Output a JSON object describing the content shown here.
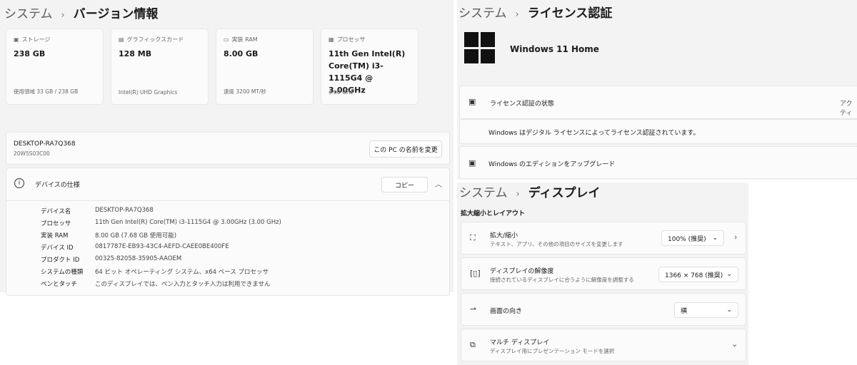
{
  "about": {
    "crumb_parent": "システム",
    "crumb_current": "バージョン情報",
    "cards": [
      {
        "icon": "storage-icon",
        "label": "ストレージ",
        "value": "238 GB",
        "sub": "使用領域 33 GB / 238 GB"
      },
      {
        "icon": "gpu-icon",
        "label": "グラフィックスカード",
        "value": "128 MB",
        "sub": "Intel(R) UHD Graphics"
      },
      {
        "icon": "ram-icon",
        "label": "実装 RAM",
        "value": "8.00 GB",
        "sub": "速度 3200 MT/秒"
      },
      {
        "icon": "processor-icon",
        "label": "プロセッサ",
        "value": "11th Gen Intel(R) Core(TM) i3-1115G4 @ 3.00GHz",
        "sub": "3.00 GHz"
      }
    ],
    "device_name": "DESKTOP-RA7Q368",
    "model": "20W5S03C00",
    "rename_button": "この PC の名前を変更",
    "specs_title": "デバイスの仕様",
    "copy_button": "コピー",
    "specs": [
      {
        "k": "デバイス名",
        "v": "DESKTOP-RA7Q368"
      },
      {
        "k": "プロセッサ",
        "v": "11th Gen Intel(R) Core(TM) i3-1115G4 @ 3.00GHz (3.00 GHz)"
      },
      {
        "k": "実装 RAM",
        "v": "8.00 GB (7.68 GB 使用可能)"
      },
      {
        "k": "デバイス ID",
        "v": "0817787E-EB93-43C4-AEFD-CAEE0BE400FE"
      },
      {
        "k": "プロダクト ID",
        "v": "00325-82058-35905-AAOEM"
      },
      {
        "k": "システムの種類",
        "v": "64 ビット オペレーティング システム、x64 ベース プロセッサ"
      },
      {
        "k": "ペンとタッチ",
        "v": "このディスプレイでは、ペン入力とタッチ入力は利用できません"
      }
    ]
  },
  "activation": {
    "crumb_parent": "システム",
    "crumb_current": "ライセンス認証",
    "edition": "Windows 11 Home",
    "status_label": "ライセンス認証の状態",
    "status_value": "アクティ",
    "status_detail": "Windows はデジタル ライセンスによってライセンス認証されています。",
    "upgrade_label": "Windows のエディションをアップグレード"
  },
  "display": {
    "crumb_parent": "システム",
    "crumb_current": "ディスプレイ",
    "section": "拡大縮小とレイアウト",
    "rows": [
      {
        "title": "拡大/縮小",
        "desc": "テキスト、アプリ、その他の項目のサイズを変更します",
        "value": "100% (推奨)"
      },
      {
        "title": "ディスプレイの解像度",
        "desc": "接続されているディスプレイに合うように解像度を調整する",
        "value": "1366 × 768 (推奨)"
      },
      {
        "title": "画面の向き",
        "desc": "",
        "value": "横"
      },
      {
        "title": "マルチ ディスプレイ",
        "desc": "ディスプレイ用にプレゼンテーション モードを選択",
        "value": ""
      }
    ]
  }
}
